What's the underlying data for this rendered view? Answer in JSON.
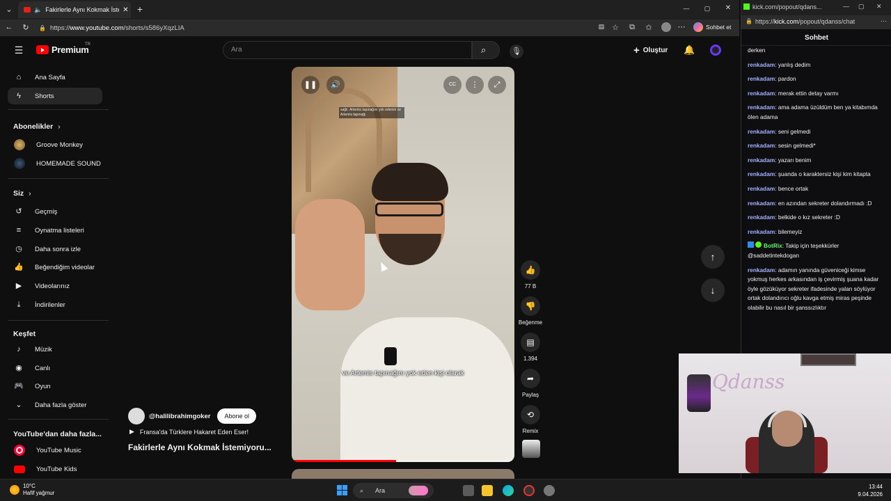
{
  "browser": {
    "tab_title": "Fakirlerle Aynı Kokmak İstemi",
    "url_prefix": "https://",
    "url_host": "www.youtube.com",
    "url_path": "/shorts/s586yXqzLIA",
    "copilot_label": "Sohbet et"
  },
  "youtube": {
    "logo_text": "Premium",
    "region": "TR",
    "search_placeholder": "Ara",
    "create_label": "Oluştur",
    "accent": "#ff0000"
  },
  "sidebar": {
    "main": [
      {
        "label": "Ana Sayfa",
        "icon": "home-icon"
      },
      {
        "label": "Shorts",
        "icon": "shorts-icon"
      }
    ],
    "subscriptions_title": "Abonelikler",
    "subscriptions": [
      {
        "label": "Groove Monkey"
      },
      {
        "label": "HOMEMADE SOUND"
      }
    ],
    "you_title": "Siz",
    "you": [
      {
        "label": "Geçmiş",
        "icon": "history-icon"
      },
      {
        "label": "Oynatma listeleri",
        "icon": "playlist-icon"
      },
      {
        "label": "Daha sonra izle",
        "icon": "clock-icon"
      },
      {
        "label": "Beğendiğim videolar",
        "icon": "thumbs-up-icon"
      },
      {
        "label": "Videolarınız",
        "icon": "video-icon"
      },
      {
        "label": "İndirilenler",
        "icon": "download-icon"
      }
    ],
    "explore_title": "Keşfet",
    "explore": [
      {
        "label": "Müzik",
        "icon": "music-icon"
      },
      {
        "label": "Canlı",
        "icon": "live-icon"
      },
      {
        "label": "Oyun",
        "icon": "gaming-icon"
      },
      {
        "label": "Daha fazla göster",
        "icon": "chevron-down-icon"
      }
    ],
    "more_title": "YouTube'dan daha fazla...",
    "more": [
      {
        "label": "YouTube Music"
      },
      {
        "label": "YouTube Kids"
      }
    ]
  },
  "short": {
    "caption_small": "sağlı. Artemis tapınağını yok edenini ve Artemis tapınağı",
    "caption": "ve Artemis tapınağını yok eden kişi olarak",
    "progress": 0.47,
    "channel": "@halilibrahimgoker",
    "subscribe_label": "Abone ol",
    "playlist": "Fransa'da Türklere Hakaret Eden Eser!",
    "title": "Fakirlerle Aynı Kokmak İstemiyoru...",
    "likes": "77 B",
    "dislike_label": "Beğenme",
    "comments": "1.394",
    "share_label": "Paylaş",
    "remix_label": "Remix"
  },
  "chat_window": {
    "tab_title": "kick.com/popout/qdans...",
    "url_prefix": "https://",
    "url_host": "kick.com",
    "url_path": "/popout/qdanss/chat",
    "title": "Sohbet",
    "first_line": "derken",
    "messages": [
      {
        "user": "renkadam",
        "text": "yanlış dedim"
      },
      {
        "user": "renkadam",
        "text": "pardon"
      },
      {
        "user": "renkadam",
        "text": "merak ettin detay varmı"
      },
      {
        "user": "renkadam",
        "text": "ama adama üzüldüm ben ya kitabımda ölen adama"
      },
      {
        "user": "renkadam",
        "text": "seni gelmedi"
      },
      {
        "user": "renkadam",
        "text": "sesin gelmedi*"
      },
      {
        "user": "renkadam",
        "text": "yazarı benim"
      },
      {
        "user": "renkadam",
        "text": "şuanda o karaktersiz kişi kim kitapta"
      },
      {
        "user": "renkadam",
        "text": "bence ortak"
      },
      {
        "user": "renkadam",
        "text": "en azından sekreter dolandırmadı :D"
      },
      {
        "user": "renkadam",
        "text": "belkide o kız sekreter :D"
      },
      {
        "user": "renkadam",
        "text": "bilemeyiz"
      },
      {
        "user": "BotRix",
        "text": "Takip için teşekkürler @saddetintekdogan"
      },
      {
        "user": "renkadam",
        "text": "adamın yanında güveniceği kimse yokmuş herkes arkasından iş çevirmiş şuana kadar öyle gözüküyor sekreter ifadesinde yalan söylüyor ortak dolandırıcı oğlu kavga etmiş miras peşinde olabilir bu nasıl bir şanssızlıktır"
      }
    ],
    "streamer_logo": "Qdanss"
  },
  "taskbar": {
    "temp": "10°C",
    "weather": "Hafif yağmur",
    "search_placeholder": "Ara",
    "time": "13:44",
    "date": "9.04.2026"
  }
}
